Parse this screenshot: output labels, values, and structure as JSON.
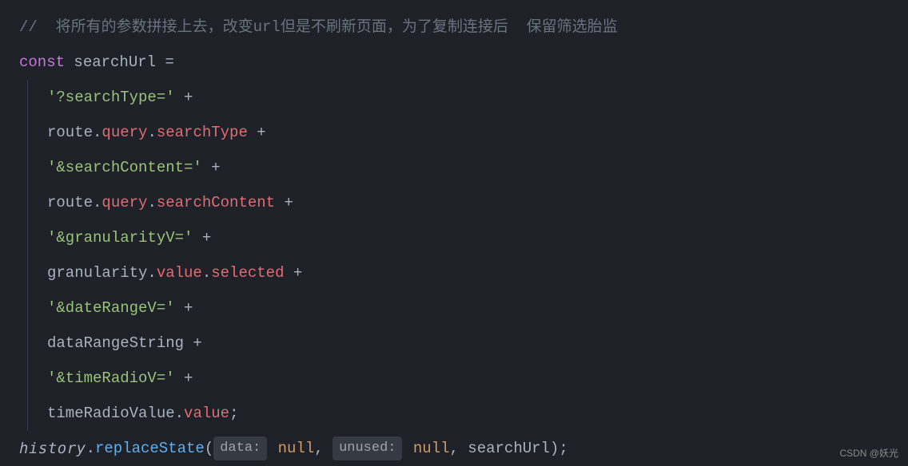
{
  "lines": {
    "l1_comment": "//  将所有的参数拼接上去，改变url但是不刷新页面，为了复制连接后  保留筛选胎监",
    "l2_const": "const",
    "l2_var": " searchUrl ",
    "l2_eq": "=",
    "l3_str": "'?searchType='",
    "l3_plus": " +",
    "l4_route": "route",
    "l4_dot1": ".",
    "l4_query": "query",
    "l4_dot2": ".",
    "l4_prop": "searchType",
    "l4_plus": " +",
    "l5_str": "'&searchContent='",
    "l5_plus": " +",
    "l6_route": "route",
    "l6_dot1": ".",
    "l6_query": "query",
    "l6_dot2": ".",
    "l6_prop": "searchContent",
    "l6_plus": " +",
    "l7_str": "'&granularityV='",
    "l7_plus": " +",
    "l8_gran": "granularity",
    "l8_dot1": ".",
    "l8_value": "value",
    "l8_dot2": ".",
    "l8_sel": "selected",
    "l8_plus": " +",
    "l9_str": "'&dateRangeV='",
    "l9_plus": " +",
    "l10_var": "dataRangeString",
    "l10_plus": " +",
    "l11_str": "'&timeRadioV='",
    "l11_plus": " +",
    "l12_var": "timeRadioValue",
    "l12_dot": ".",
    "l12_value": "value",
    "l12_semi": ";",
    "l13_hist": "history",
    "l13_dot": ".",
    "l13_method": "replaceState",
    "l13_lparen": "(",
    "l13_hint1": "data:",
    "l13_null1": " null",
    "l13_comma1": ", ",
    "l13_hint2": "unused:",
    "l13_null2": " null",
    "l13_comma2": ", searchUrl);"
  },
  "watermark": "CSDN @妖光"
}
